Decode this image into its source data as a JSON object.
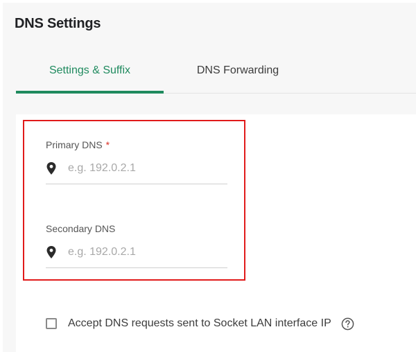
{
  "header": {
    "title": "DNS Settings"
  },
  "tabs": [
    {
      "label": "Settings & Suffix",
      "active": true
    },
    {
      "label": "DNS Forwarding",
      "active": false
    }
  ],
  "form": {
    "primary_dns": {
      "label": "Primary DNS",
      "required_mark": "*",
      "placeholder": "e.g. 192.0.2.1",
      "value": ""
    },
    "secondary_dns": {
      "label": "Secondary DNS",
      "placeholder": "e.g. 192.0.2.1",
      "value": ""
    },
    "accept_requests": {
      "label": "Accept DNS requests sent to Socket LAN interface IP",
      "checked": false,
      "help_icon": "question-circle-icon"
    }
  },
  "icons": {
    "field_icon": "map-pin-icon"
  },
  "colors": {
    "accent": "#1f8a5e",
    "highlight_border": "#e11a1a",
    "required": "#d93025"
  }
}
